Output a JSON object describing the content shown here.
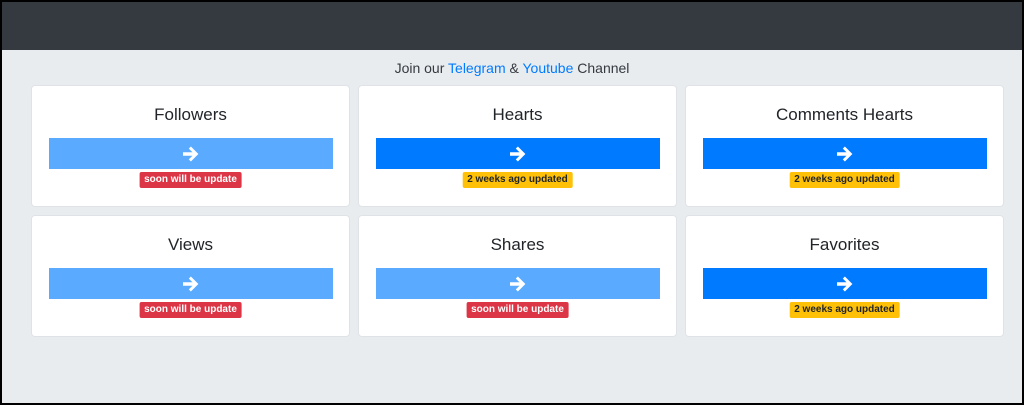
{
  "header": {
    "join_prefix": "Join our ",
    "telegram_label": "Telegram",
    "ampersand": " & ",
    "youtube_label": "Youtube",
    "join_suffix": " Channel"
  },
  "colors": {
    "topbar": "#343a40",
    "page_bg": "#e9ecef",
    "button_available": "#007bff",
    "button_pending": "#5aabff",
    "badge_danger": "#dc3545",
    "badge_warning": "#ffc107"
  },
  "services": [
    {
      "title": "Followers",
      "button_icon": "arrow-right-icon",
      "status": "soon will be update"
    },
    {
      "title": "Hearts",
      "button_icon": "arrow-right-icon",
      "status": "2 weeks ago updated"
    },
    {
      "title": "Comments Hearts",
      "button_icon": "arrow-right-icon",
      "status": "2 weeks ago updated"
    },
    {
      "title": "Views",
      "button_icon": "arrow-right-icon",
      "status": "soon will be update"
    },
    {
      "title": "Shares",
      "button_icon": "arrow-right-icon",
      "status": "soon will be update"
    },
    {
      "title": "Favorites",
      "button_icon": "arrow-right-icon",
      "status": "2 weeks ago updated"
    }
  ]
}
